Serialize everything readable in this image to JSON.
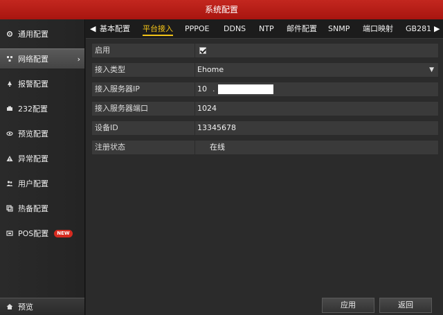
{
  "window": {
    "title": "系统配置"
  },
  "sidebar": {
    "items": [
      {
        "label": "通用配置",
        "icon": "gear-icon"
      },
      {
        "label": "网络配置",
        "icon": "network-icon",
        "active": true,
        "arrow": "›"
      },
      {
        "label": "报警配置",
        "icon": "alarm-icon"
      },
      {
        "label": "232配置",
        "icon": "serial-icon"
      },
      {
        "label": "预览配置",
        "icon": "eye-icon"
      },
      {
        "label": "异常配置",
        "icon": "warning-icon"
      },
      {
        "label": "用户配置",
        "icon": "users-icon"
      },
      {
        "label": "热备配置",
        "icon": "backup-icon"
      },
      {
        "label": "POS配置",
        "icon": "pos-icon",
        "badge": "NEW"
      }
    ],
    "preview_label": "预览"
  },
  "tabs": {
    "prev_arrow": "◀",
    "next_arrow": "▶",
    "items": [
      "基本配置",
      "平台接入",
      "PPPOE",
      "DDNS",
      "NTP",
      "邮件配置",
      "SNMP",
      "端口映射",
      "GB281"
    ],
    "active_index": 1
  },
  "form": {
    "enable_label": "启用",
    "enable_checked": true,
    "access_type_label": "接入类型",
    "access_type_value": "Ehome",
    "server_ip_label": "接入服务器IP",
    "server_ip_value": "10",
    "server_port_label": "接入服务器端口",
    "server_port_value": "1024",
    "device_id_label": "设备ID",
    "device_id_value": "13345678",
    "reg_status_label": "注册状态",
    "reg_status_value": "在线"
  },
  "buttons": {
    "apply": "应用",
    "back": "返回"
  },
  "colors": {
    "titlebar": "#b81d16",
    "active_tab": "#f5c518",
    "badge": "#d62b20"
  }
}
